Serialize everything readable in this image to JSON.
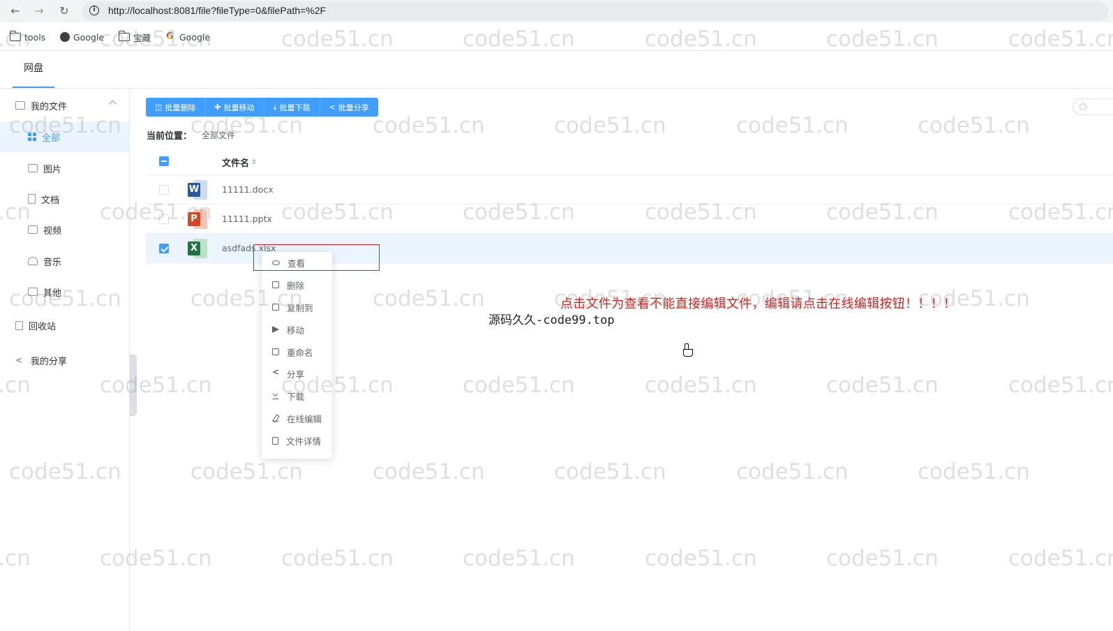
{
  "browser": {
    "url": "http://localhost:8081/file?fileType=0&filePath=%2F",
    "bookmarks": [
      "tools",
      "Google",
      "宝藏",
      "Google"
    ]
  },
  "app": {
    "tab": "网盘"
  },
  "sidebar": {
    "group_label": "我的文件",
    "items": [
      "全部",
      "图片",
      "文档",
      "视频",
      "音乐",
      "其他"
    ],
    "recycle": "回收站",
    "my_share": "我的分享"
  },
  "toolbar": {
    "buttons": [
      "批量删除",
      "批量移动",
      "批量下载",
      "批量分享"
    ]
  },
  "breadcrumb": {
    "label": "当前位置：",
    "value": "全部文件"
  },
  "table": {
    "header_name": "文件名",
    "rows": [
      {
        "name": "11111.docx",
        "type": "W",
        "color": "#2b579a",
        "checked": false
      },
      {
        "name": "11111.pptx",
        "type": "P",
        "color": "#d24726",
        "checked": false
      },
      {
        "name": "asdfads.xlsx",
        "type": "X",
        "color": "#217346",
        "checked": true
      }
    ]
  },
  "context_menu": {
    "items": [
      "查看",
      "删除",
      "复制到",
      "移动",
      "重命名",
      "分享",
      "下载",
      "在线编辑",
      "文件详情"
    ]
  },
  "annotation": "点击文件为查看不能直接编辑文件，编辑请点击在线编辑按钮！！！！",
  "signature": "源码久久-code99.top",
  "watermark": "code51.cn",
  "colors": {
    "primary": "#409eff",
    "annotation_red": "#d4201e"
  }
}
